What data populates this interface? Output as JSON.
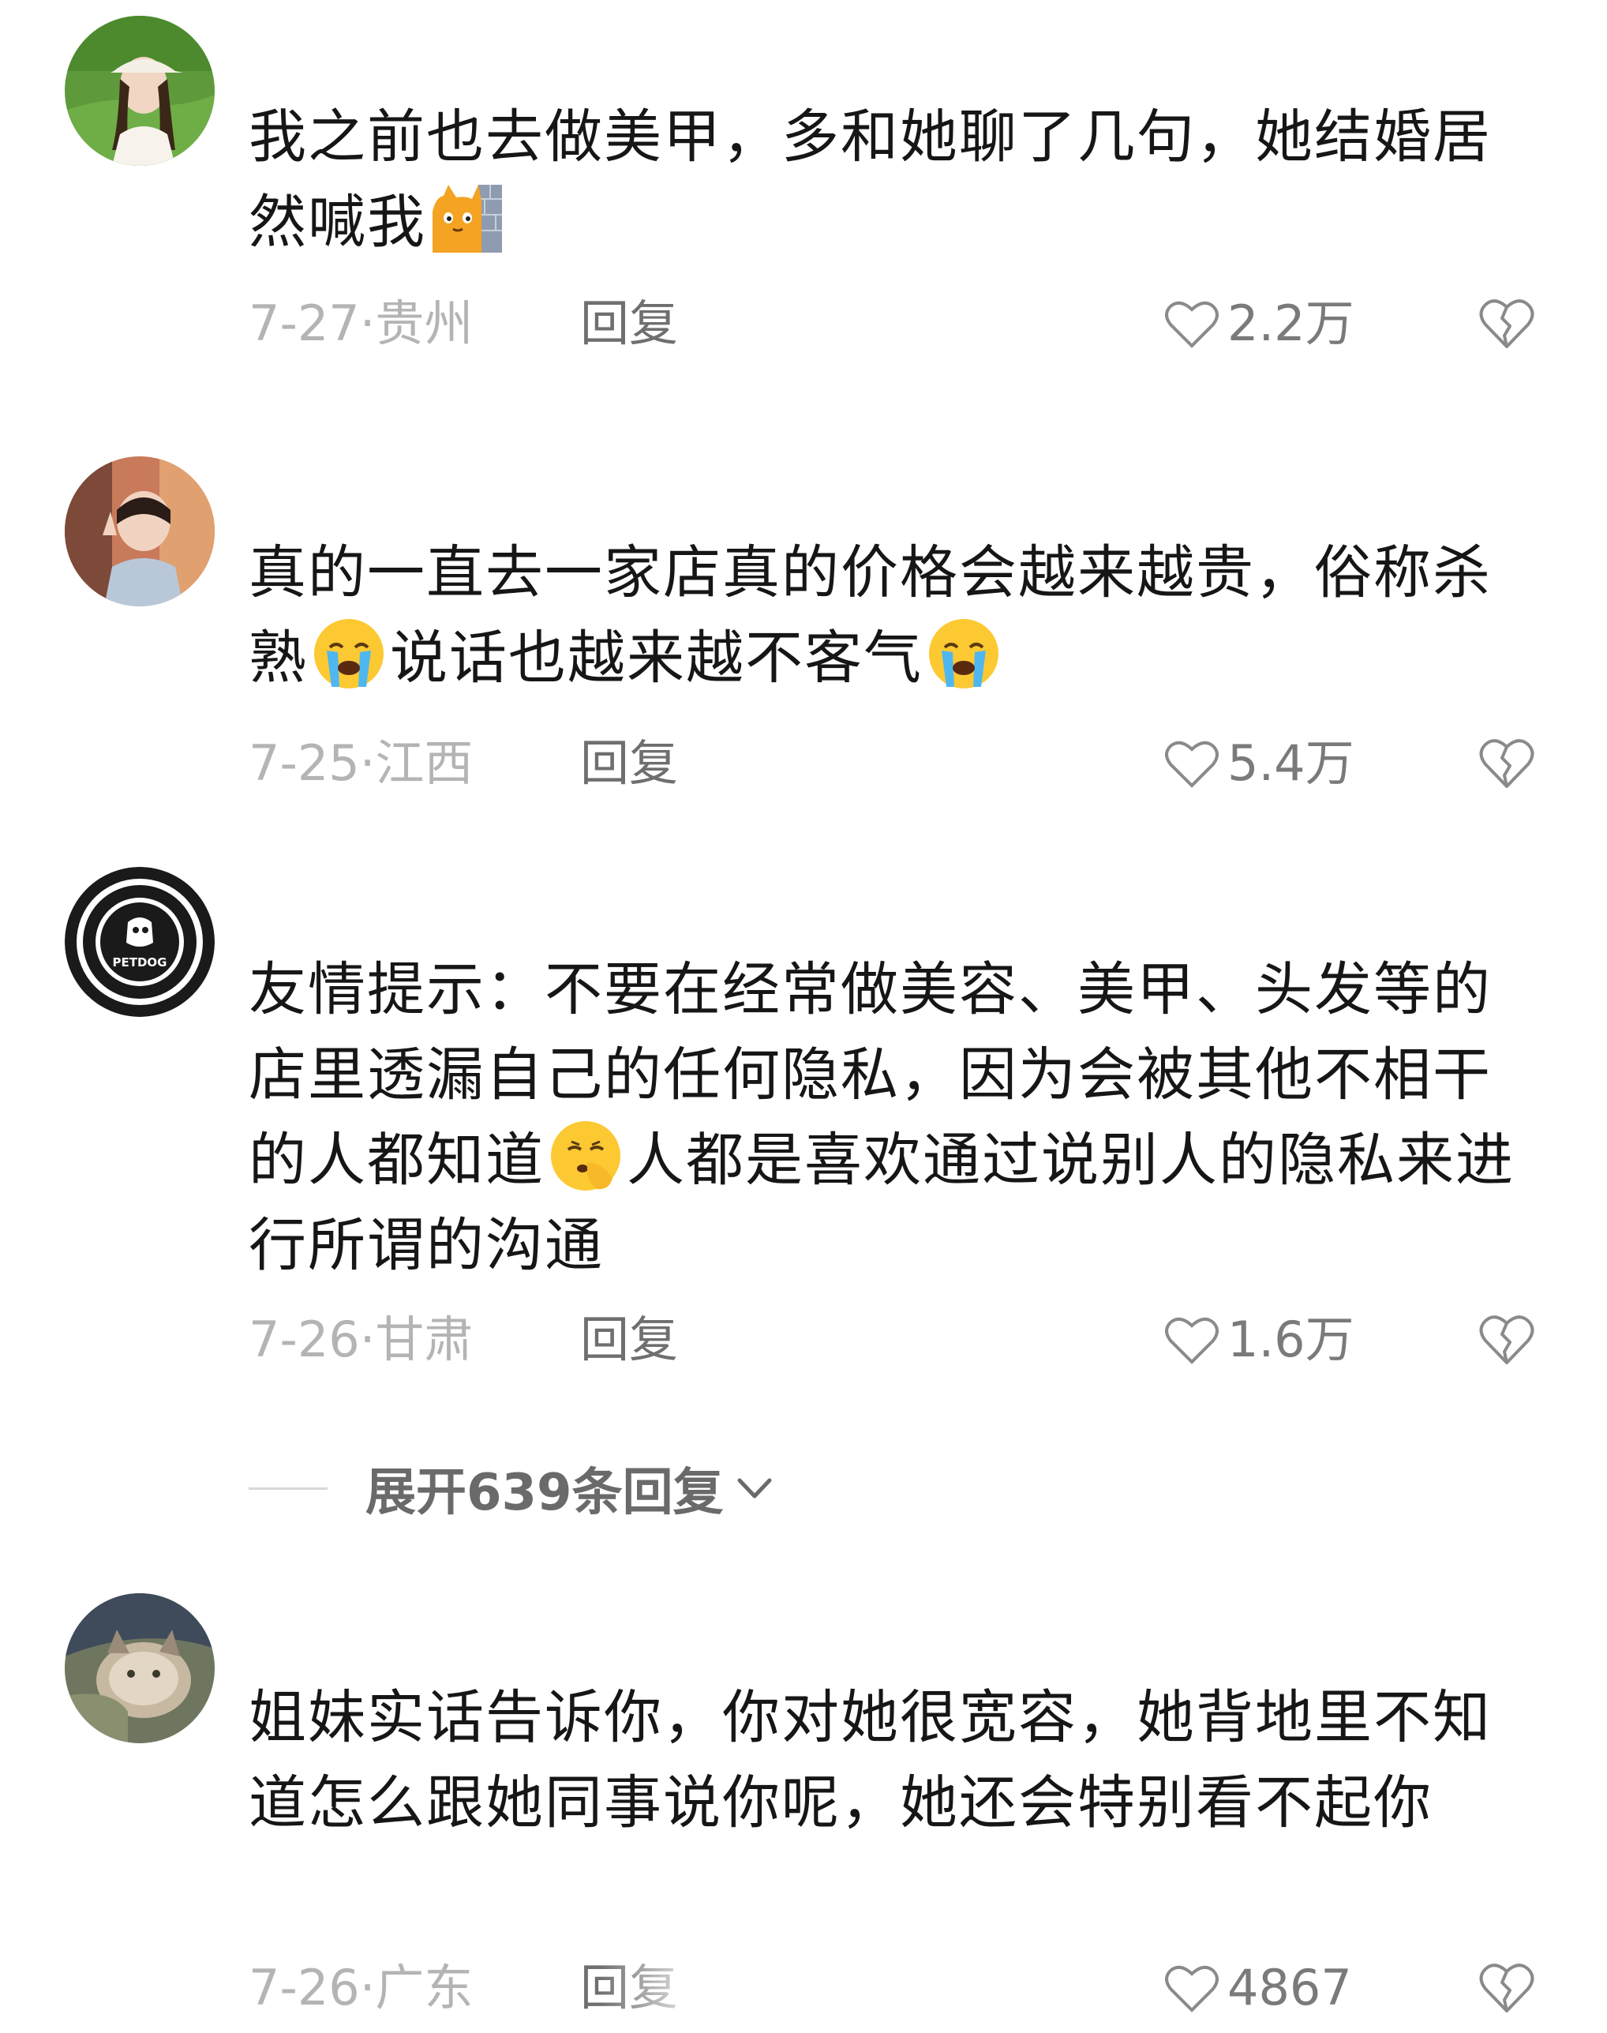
{
  "comments": [
    {
      "segments": [
        "我之前也去做美甲，多和她聊了几句，她结婚居然喊我"
      ],
      "emoji_after": [
        "cat-behind-wall-emoji"
      ],
      "date": "7-27·",
      "location": "贵州",
      "reply_label": "回复",
      "likes": "2.2万"
    },
    {
      "segments": [
        "真的一直去一家店真的价格会越来越贵，俗称杀熟",
        "说话也越来越不客气"
      ],
      "emoji_after": [
        "crying-face-emoji",
        "crying-face-emoji"
      ],
      "date": "7-25·",
      "location": "江西",
      "reply_label": "回复",
      "likes": "5.4万"
    },
    {
      "segments": [
        "友情提示：不要在经常做美容、美甲、头发等的店里透漏自己的任何隐私，因为会被其他不相干的人都知道",
        "人都是喜欢通过说别人的隐私来进行所谓的沟通"
      ],
      "emoji_after": [
        "shushing-face-emoji"
      ],
      "avatar_text": "PETDOG",
      "date": "7-26·",
      "location": "甘肃",
      "reply_label": "回复",
      "likes": "1.6万"
    },
    {
      "segments": [
        "姐妹实话告诉你，你对她很宽容，她背地里不知道怎么跟她同事说你呢，她还会特别看不起你"
      ],
      "emoji_after": [],
      "date": "7-26·",
      "location": "广东",
      "reply_label": "回复",
      "likes": "4867"
    }
  ],
  "expand_replies": "展开639条回复",
  "colors": {
    "text": "#161616",
    "meta": "#b4b4b4",
    "reply": "#6f6f6f",
    "icon": "#8a8a8a"
  }
}
